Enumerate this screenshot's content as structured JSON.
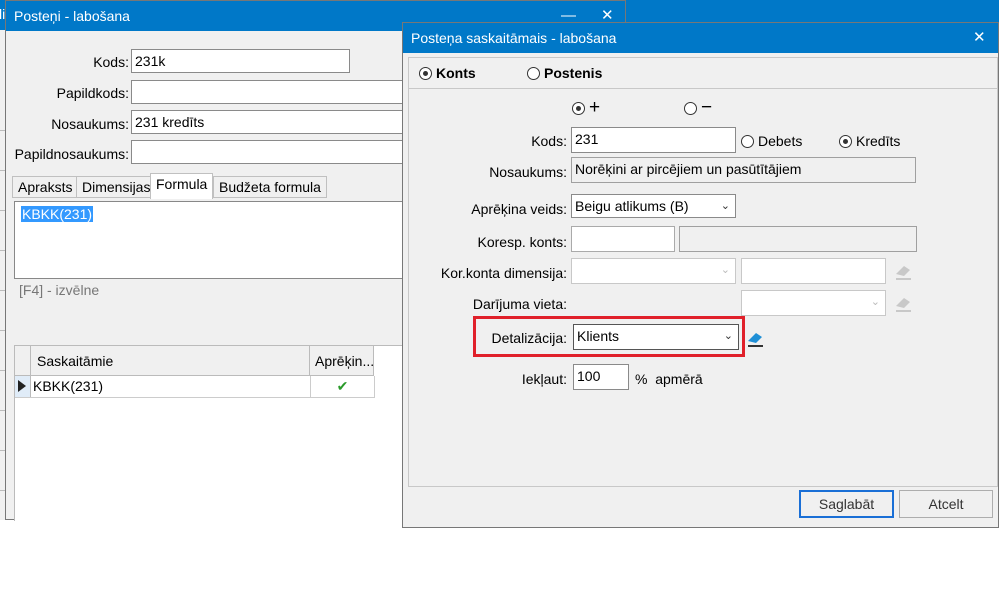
{
  "background_app": {
    "title_fragment": "li"
  },
  "left_window": {
    "title": "Posteņi - labošana",
    "minimize": "—",
    "close": "✕",
    "fields": {
      "kods_label": "Kods:",
      "kods_value": "231k",
      "papildkods_label": "Papildkods:",
      "papildkods_value": "",
      "nosaukums_label": "Nosaukums:",
      "nosaukums_value": "231 kredīts",
      "papildnosaukums_label": "Papildnosaukums:",
      "papildnosaukums_value": ""
    },
    "tabs": [
      "Apraksts",
      "Dimensijas",
      "Formula",
      "Budžeta formula"
    ],
    "active_tab": "Formula",
    "formula_text": "KBKK(231)",
    "hint": "[F4] - izvēlne",
    "grid": {
      "columns": [
        "Saskaitāmie",
        "Aprēķin..."
      ],
      "rows": [
        {
          "saskaitamie": "KBKK(231)",
          "aprekins": "✔"
        }
      ]
    }
  },
  "dialog": {
    "title": "Posteņa saskaitāmais - labošana",
    "close": "✕",
    "source_options": [
      {
        "label": "Konts",
        "selected": true
      },
      {
        "label": "Postenis",
        "selected": false
      }
    ],
    "sign_options": [
      {
        "label": "+",
        "selected": true
      },
      {
        "label": "−",
        "selected": false
      }
    ],
    "kods_label": "Kods:",
    "kods_value": "231",
    "side_options": [
      {
        "label": "Debets",
        "selected": false
      },
      {
        "label": "Kredīts",
        "selected": true
      }
    ],
    "nosaukums_label": "Nosaukums:",
    "nosaukums_value": "Norēķini ar pircējiem un pasūtītājiem",
    "aprekina_label": "Aprēķina veids:",
    "aprekina_value": "Beigu atlikums (B)",
    "koresp_label": "Koresp. konts:",
    "koresp_value": "",
    "koresp_name": "",
    "kordim_label": "Kor.konta dimensija:",
    "kordim_value": "",
    "kordim_name": "",
    "vieta_label": "Darījuma vieta:",
    "vieta_value": "",
    "detal_label": "Detalizācija:",
    "detal_value": "Klients",
    "iekl_label": "Iekļaut:",
    "iekl_value": "100",
    "iekl_suffix": "%  apmērā",
    "save": "Saglabāt",
    "cancel": "Atcelt",
    "highlight_color": "#e0202a"
  }
}
